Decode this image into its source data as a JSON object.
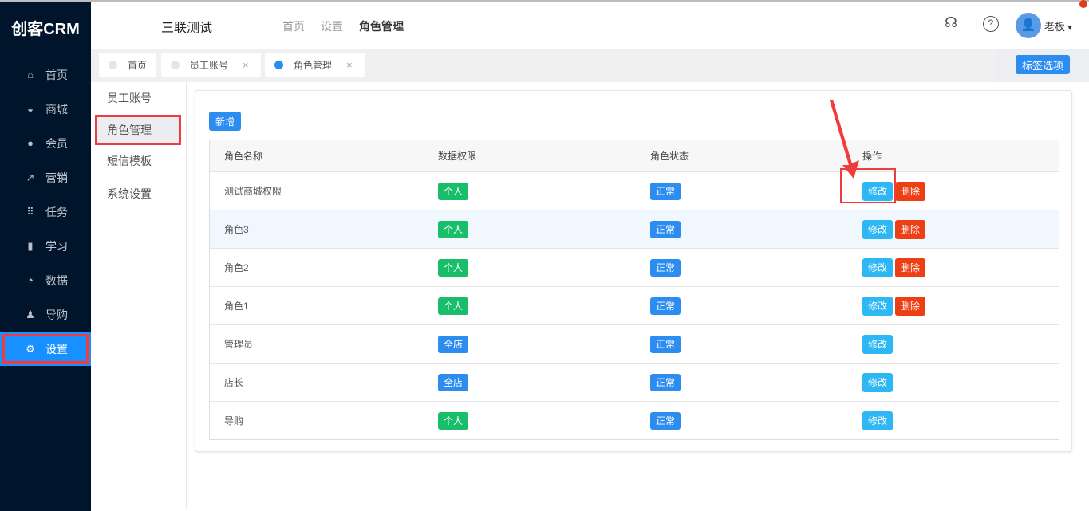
{
  "logo": "创客CRM",
  "sidebar": {
    "items": [
      {
        "label": "首页",
        "icon": "home-icon",
        "glyph": "⌂"
      },
      {
        "label": "商城",
        "icon": "mall-icon",
        "glyph": "◒"
      },
      {
        "label": "会员",
        "icon": "user-icon",
        "glyph": "●"
      },
      {
        "label": "营销",
        "icon": "trend-icon",
        "glyph": "↗"
      },
      {
        "label": "任务",
        "icon": "grid-icon",
        "glyph": "⠿"
      },
      {
        "label": "学习",
        "icon": "book-icon",
        "glyph": "▮"
      },
      {
        "label": "数据",
        "icon": "pie-chart-icon",
        "glyph": "◔"
      },
      {
        "label": "导购",
        "icon": "group-icon",
        "glyph": "♟"
      },
      {
        "label": "设置",
        "icon": "gear-icon",
        "glyph": "⚙"
      }
    ]
  },
  "header": {
    "app_title": "三联测试",
    "breadcrumbs": [
      "首页",
      "设置",
      "角色管理"
    ],
    "user": "老板",
    "support_glyph": "☊",
    "help_glyph": "?",
    "avatar_glyph": "👤",
    "caret": "▾"
  },
  "tabs": [
    {
      "label": "首页",
      "active": false
    },
    {
      "label": "员工账号",
      "active": false,
      "close": "×"
    },
    {
      "label": "角色管理",
      "active": true,
      "close": "×"
    }
  ],
  "tab_options_label": "标签选项",
  "submenu": [
    "员工账号",
    "角色管理",
    "短信模板",
    "系统设置"
  ],
  "add_label": "新增",
  "table": {
    "columns": [
      "角色名称",
      "数据权限",
      "角色状态",
      "操作"
    ],
    "rows": [
      {
        "name": "测试商城权限",
        "scope": "个人",
        "status": "正常",
        "edit": "修改",
        "delete": "删除"
      },
      {
        "name": "角色3",
        "scope": "个人",
        "status": "正常",
        "edit": "修改",
        "delete": "删除"
      },
      {
        "name": "角色2",
        "scope": "个人",
        "status": "正常",
        "edit": "修改",
        "delete": "删除"
      },
      {
        "name": "角色1",
        "scope": "个人",
        "status": "正常",
        "edit": "修改",
        "delete": "删除"
      },
      {
        "name": "管理员",
        "scope": "全店",
        "status": "正常",
        "edit": "修改"
      },
      {
        "name": "店长",
        "scope": "全店",
        "status": "正常",
        "edit": "修改"
      },
      {
        "name": "导购",
        "scope": "个人",
        "status": "正常",
        "edit": "修改"
      }
    ]
  },
  "colors": {
    "personal": "#19be6b",
    "store": "#2d8cf0",
    "status": "#2d8cf0",
    "edit": "#2db7f5",
    "delete": "#ed3f14",
    "annotation": "#f03c3c"
  }
}
